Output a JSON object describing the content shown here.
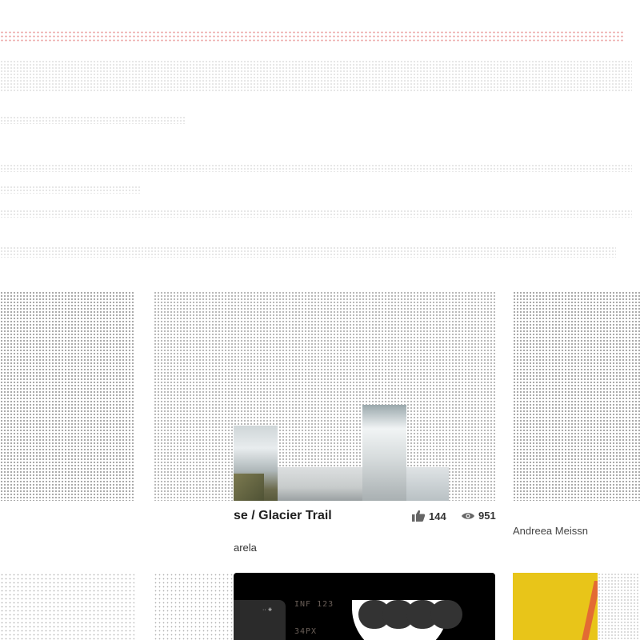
{
  "main_card": {
    "title": "se / Glacier Trail",
    "likes": "144",
    "views": "951",
    "author": "arela"
  },
  "right_card": {
    "author": "Andreea Meissn"
  },
  "second_card": {
    "phone_status": "·· ⧺",
    "code_line_1": "INF 123",
    "code_line_2": "34PX"
  },
  "icons": {
    "likes": "thumbs-up-icon",
    "views": "eye-icon"
  },
  "colors": {
    "accent_red": "#d23a3a",
    "yellow_card": "#e8c519",
    "orange_stripe": "#e36b33"
  }
}
